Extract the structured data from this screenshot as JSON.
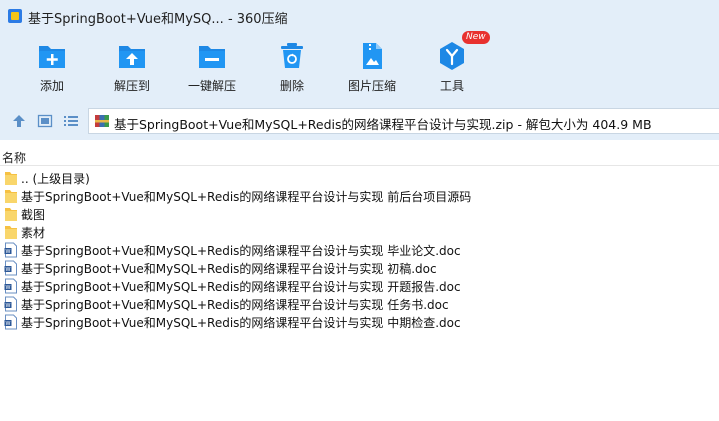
{
  "window": {
    "title": "基于SpringBoot+Vue和MySQ... - 360压缩"
  },
  "toolbar": {
    "items": [
      {
        "label": "添加",
        "icon": "add-folder-icon"
      },
      {
        "label": "解压到",
        "icon": "extract-to-icon"
      },
      {
        "label": "一键解压",
        "icon": "one-click-extract-icon"
      },
      {
        "label": "删除",
        "icon": "trash-icon"
      },
      {
        "label": "图片压缩",
        "icon": "image-compress-icon"
      },
      {
        "label": "工具",
        "icon": "tools-icon",
        "badge": "New"
      }
    ]
  },
  "address": {
    "text": "基于SpringBoot+Vue和MySQL+Redis的网络课程平台设计与实现.zip - 解包大小为 404.9 MB"
  },
  "list": {
    "column_name": "名称",
    "rows": [
      {
        "name": ".. (上级目录)",
        "type": "folder"
      },
      {
        "name": "基于SpringBoot+Vue和MySQL+Redis的网络课程平台设计与实现 前后台项目源码",
        "type": "folder"
      },
      {
        "name": "截图",
        "type": "folder"
      },
      {
        "name": "素材",
        "type": "folder"
      },
      {
        "name": "基于SpringBoot+Vue和MySQL+Redis的网络课程平台设计与实现 毕业论文.doc",
        "type": "doc"
      },
      {
        "name": "基于SpringBoot+Vue和MySQL+Redis的网络课程平台设计与实现 初稿.doc",
        "type": "doc"
      },
      {
        "name": "基于SpringBoot+Vue和MySQL+Redis的网络课程平台设计与实现 开题报告.doc",
        "type": "doc"
      },
      {
        "name": "基于SpringBoot+Vue和MySQL+Redis的网络课程平台设计与实现 任务书.doc",
        "type": "doc"
      },
      {
        "name": "基于SpringBoot+Vue和MySQL+Redis的网络课程平台设计与实现 中期检查.doc",
        "type": "doc"
      }
    ]
  },
  "colors": {
    "header_bg": "#e3eef9",
    "icon_blue": "#1e88e5",
    "folder_yellow": "#f6c143",
    "badge_red": "#e8312f"
  }
}
